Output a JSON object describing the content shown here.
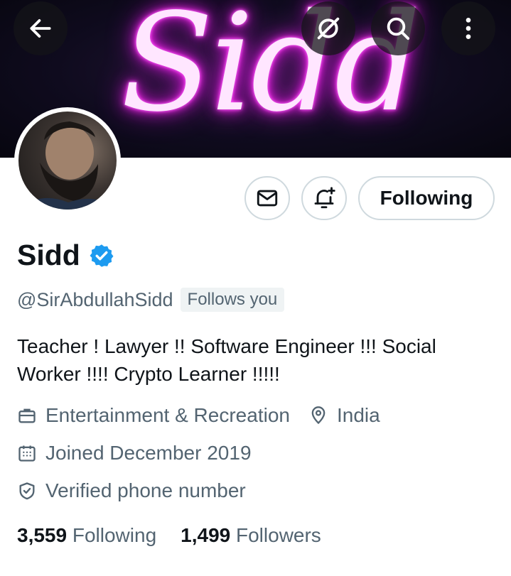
{
  "banner": {
    "neon_text": "Sidd"
  },
  "profile": {
    "name": "Sidd",
    "handle": "@SirAbdullahSidd",
    "follows_you": "Follows you",
    "bio": "Teacher ! Lawyer !! Software Engineer !!! Social Worker !!!! Crypto Learner !!!!!",
    "category": "Entertainment & Recreation",
    "location": "India",
    "joined": "Joined December 2019",
    "verified_phone": "Verified phone number",
    "following_count": "3,559",
    "following_label": "Following",
    "followers_count": "1,499",
    "followers_label": "Followers"
  },
  "actions": {
    "following_button": "Following"
  },
  "icons": {
    "back": "back-arrow-icon",
    "grok": "slashed-circle-icon",
    "search": "search-icon",
    "more": "more-vertical-icon",
    "message": "envelope-icon",
    "notify": "bell-plus-icon",
    "verified": "verified-badge-icon",
    "category": "briefcase-icon",
    "location": "location-pin-icon",
    "calendar": "calendar-icon",
    "shield": "shield-check-icon"
  },
  "colors": {
    "verified_blue": "#1d9bf0",
    "neon_pink": "#ff2cf0",
    "secondary_text": "#536471"
  }
}
